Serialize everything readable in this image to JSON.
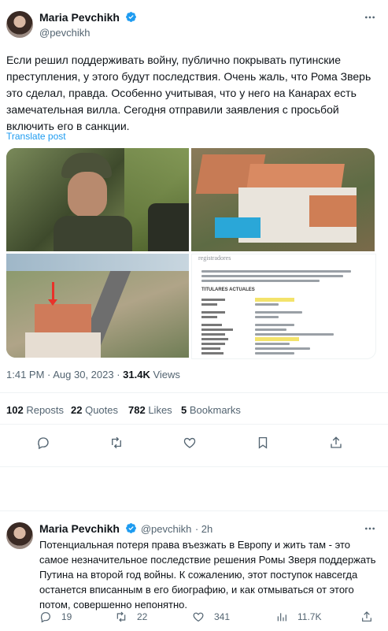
{
  "tweet": {
    "author_name": "Maria Pevchikh",
    "author_handle": "@pevchikh",
    "text": "Если решил поддерживать войну, публично покрывать путинские преступления, у этого будут последствия. Очень жаль, что Рома Зверь это сделал, правда. Особенно учитывая, что у него на Канарах есть замечательная вилла. Сегодня отправили заявления с просьбой включить его в санкции.",
    "translate_label": "Translate post",
    "time": "1:41 PM · Aug 30, 2023 · ",
    "views_count": "31.4K",
    "views_label": " Views",
    "doc_header": "registradores",
    "doc_section_title": "TITULARES ACTUALES",
    "stats": {
      "reposts_count": "102",
      "reposts_label": "Reposts",
      "quotes_count": "22",
      "quotes_label": "Quotes",
      "likes_count": "782",
      "likes_label": "Likes",
      "bookmarks_count": "5",
      "bookmarks_label": "Bookmarks"
    }
  },
  "reply": {
    "author_name": "Maria Pevchikh",
    "author_handle": "@pevchikh",
    "time": "· 2h",
    "text": "Потенциальная потеря права въезжать в Европу и жить там - это самое незначительное последствие решения Ромы Зверя поддержать Путина на второй год войны. К сожалению, этот поступок навсегда останется вписанным в его биографию, и как отмываться от этого потом, совершенно непонятно.",
    "reply_count": "19",
    "repost_count": "22",
    "like_count": "341",
    "views_count": "11.7K"
  },
  "colors": {
    "accent": "#1d9bf0",
    "text": "#0f1419",
    "secondary": "#536471",
    "divider": "#eff3f4"
  },
  "icons": [
    "verified-badge-icon",
    "more-icon",
    "reply-icon",
    "repost-icon",
    "like-icon",
    "bookmark-icon",
    "views-icon",
    "share-icon"
  ]
}
